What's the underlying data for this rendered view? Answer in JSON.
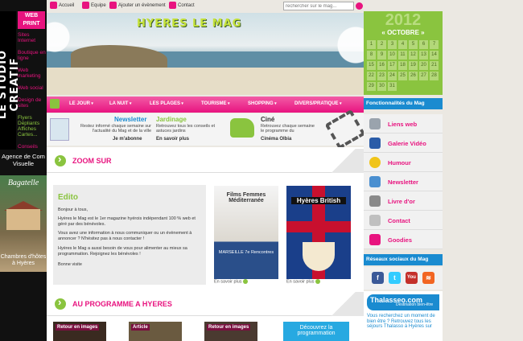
{
  "topbar": {
    "nav": [
      "Accueil",
      "Equipe",
      "Ajouter un évènement",
      "Contact"
    ],
    "search_placeholder": "rechercher sur le mag..."
  },
  "leftbar": {
    "studio": "LE STUDIO CREATIF",
    "webprint": "WEB PRINT",
    "items": [
      {
        "label": "Sites Internet",
        "color": "pink"
      },
      {
        "label": "Boutique en ligne",
        "color": "pink"
      },
      {
        "label": "Web marketing",
        "color": "pink"
      },
      {
        "label": "Web social",
        "color": "pink"
      },
      {
        "label": "Design de sites",
        "color": "pink"
      },
      {
        "label": "Flyers Dépliants Affiches Cartes...",
        "color": "green"
      },
      {
        "label": "Conseils",
        "color": "pink"
      }
    ],
    "agence": "Agence de Com Visuelle",
    "bagatelle_title": "Bagatelle",
    "bagatelle_sub": "Chambres d'hôtes à Hyères"
  },
  "banner": {
    "logo": "HYERES LE MAG"
  },
  "menu": [
    "LE JOUR",
    "LA NUIT",
    "LES PLAGES",
    "TOURISME",
    "SHOPPING",
    "DIVERS/PRATIQUE"
  ],
  "features": [
    {
      "title": "Newsletter",
      "desc": "Restez informé chaque semaine sur l'actualité du Mag et de la ville",
      "link": "Je m'abonne"
    },
    {
      "title": "Jardinage",
      "desc": "Retrouvez tous les conseils et astuces jardins",
      "link": "En savoir plus"
    },
    {
      "title": "Ciné",
      "desc": "Retrouvez chaque semaine le programme du",
      "link": "Cinéma Olbia"
    }
  ],
  "zoom": {
    "title": "ZOOM SUR"
  },
  "edito": {
    "title": "Edito",
    "p1": "Bonjour à tous,",
    "p2": "Hyères le Mag est le 1er magazine hyérois indépendant 100 % web et géré par des bénévoles.",
    "p3": "Vous avez une information à nous communiquer ou un évènement à annoncer ? N'hésitez pas à nous contacter !",
    "p4": "Hyères le Mag a aussi besoin de vous pour alimenter au mieux sa programmation. Rejoignez les bénévoles !",
    "p5": "Bonne visite"
  },
  "posters": [
    {
      "title": "Films Femmes Méditerranée",
      "sub": "MARSEILLE 7e Rencontres",
      "caption": "En savoir plus"
    },
    {
      "title": "Hyères British",
      "sub": "",
      "caption": "En savoir plus"
    }
  ],
  "programme": {
    "title": "AU PROGRAMME A HYERES"
  },
  "thumbs": [
    "Retour en images",
    "Article",
    "Retour en images",
    "Découvrez la programmation"
  ],
  "calendar": {
    "year": "2012",
    "month": "OCTOBRE",
    "days": [
      "1",
      "2",
      "3",
      "4",
      "5",
      "6",
      "7",
      "8",
      "9",
      "10",
      "11",
      "12",
      "13",
      "14",
      "15",
      "16",
      "17",
      "18",
      "19",
      "20",
      "21",
      "22",
      "23",
      "24",
      "25",
      "26",
      "27",
      "28",
      "29",
      "30",
      "31"
    ]
  },
  "right": {
    "func_head": "Fonctionnalités du Mag",
    "items": [
      {
        "label": "Liens web",
        "icon": "link-icon",
        "color": "#9aa3ad"
      },
      {
        "label": "Galerie Vidéo",
        "icon": "video-icon",
        "color": "#2a5ca8"
      },
      {
        "label": "Humour",
        "icon": "smiley-icon",
        "color": "#f0c419"
      },
      {
        "label": "Newsletter",
        "icon": "newsletter-icon",
        "color": "#4a8fd0"
      },
      {
        "label": "Livre d'or",
        "icon": "book-icon",
        "color": "#8a8a8a"
      },
      {
        "label": "Contact",
        "icon": "mail-icon",
        "color": "#c0c0c0"
      },
      {
        "label": "Goodies",
        "icon": "gift-icon",
        "color": "#e8137f"
      }
    ],
    "social_head": "Réseaux sociaux du Mag",
    "thalasseo_brand": "Thalasseo.com",
    "thalasseo_tag": "Destination bien-être",
    "thalasseo_text": "Vous recherchez un moment de bien être ? Retrouvez tous les séjours Thalasso à Hyères sur"
  }
}
